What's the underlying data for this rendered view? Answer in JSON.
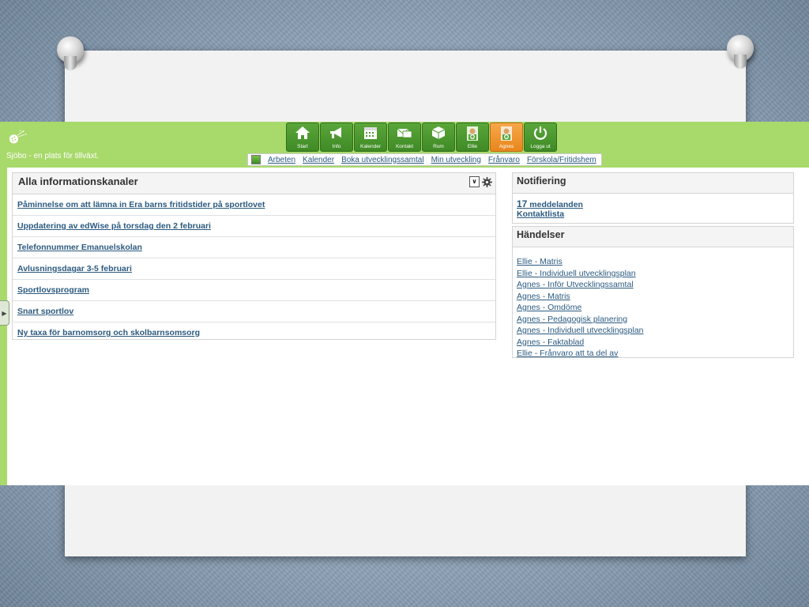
{
  "header": {
    "logo_text": "Sjöbo - en plats för tillväxt."
  },
  "nav": {
    "items": [
      {
        "label": "Start",
        "icon": "home-icon"
      },
      {
        "label": "Info",
        "icon": "megaphone-icon"
      },
      {
        "label": "Kalender",
        "icon": "calendar-icon"
      },
      {
        "label": "Kontakt",
        "icon": "mail-icon"
      },
      {
        "label": "Rum",
        "icon": "cube-icon"
      },
      {
        "label": "Ellie",
        "icon": "user-icon"
      },
      {
        "label": "Agnes",
        "icon": "user-icon",
        "active": true
      },
      {
        "label": "Logga ut",
        "icon": "power-icon"
      }
    ],
    "active_color": "#e8861c",
    "button_color": "#4a9a2e"
  },
  "subnav": {
    "items": [
      "Arbeten",
      "Kalender",
      "Boka utvecklingssamtal",
      "Min utveckling",
      "Frånvaro",
      "Förskola/Fritidshem"
    ]
  },
  "main": {
    "title": "Alla informationskanaler",
    "dropdown_glyph": "∨",
    "news": [
      "Påminnelse om att lämna in Era barns fritidstider på sportlovet",
      "Uppdatering av edWise på torsdag den 2 februari",
      "Telefonnummer Emanuelskolan",
      "Avlusningsdagar 3-5 februari",
      "Sportlovsprogram",
      "Snart sportlov",
      "Ny taxa för barnomsorg och skolbarnsomsorg"
    ]
  },
  "notification": {
    "title": "Notifiering",
    "count": "17",
    "messages_label": "meddelanden",
    "contact_list": "Kontaktlista"
  },
  "events": {
    "title": "Händelser",
    "items": [
      "Ellie - Matris",
      "Ellie - Individuell utvecklingsplan",
      "Agnes - Inför Utvecklingssamtal",
      "Agnes - Matris",
      "Agnes - Omdöme",
      "Agnes - Pedagogisk planering",
      "Agnes - Individuell utvecklingsplan",
      "Agnes - Faktablad",
      "Ellie - Frånvaro att ta del av"
    ]
  },
  "theme": {
    "header_green": "#a8d96b",
    "link_blue": "#2b5a80"
  }
}
